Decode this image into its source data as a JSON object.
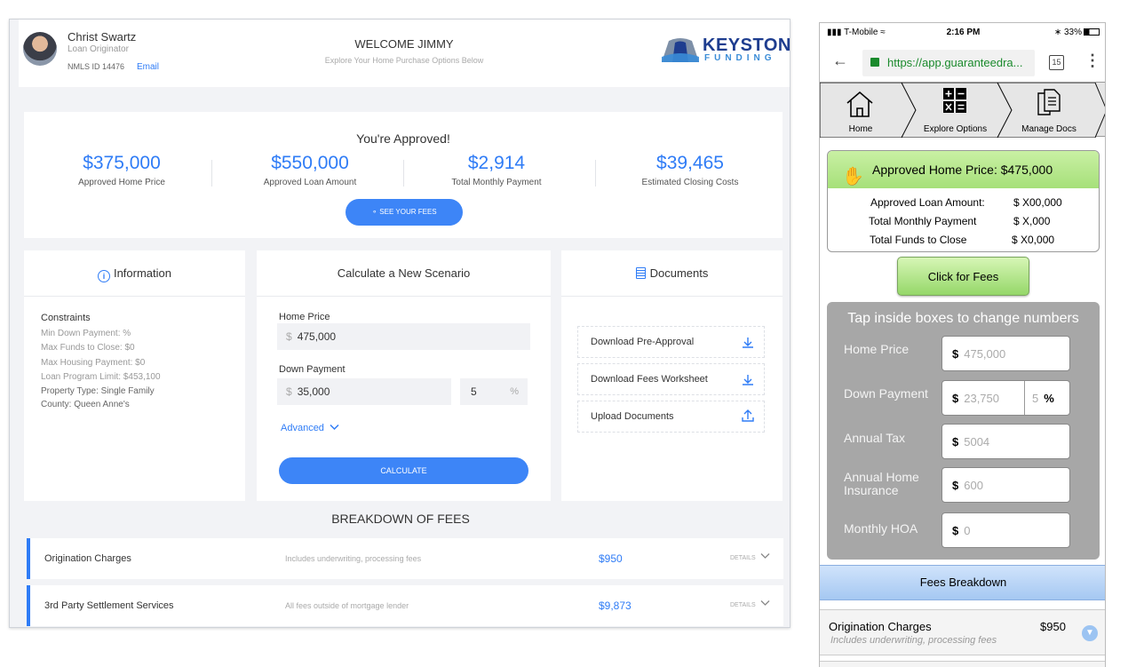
{
  "desktop": {
    "header": {
      "lo_name": "Christ Swartz",
      "lo_title": "Loan Originator",
      "nmls": "NMLS ID 14476",
      "email_label": "Email",
      "welcome": "WELCOME JIMMY",
      "welcome_sub": "Explore Your Home Purchase Options Below",
      "logo_main": "KEYSTONE",
      "logo_sub": "FUNDING"
    },
    "approved": {
      "title": "You're Approved!",
      "stats": [
        {
          "value": "$375,000",
          "label": "Approved Home Price"
        },
        {
          "value": "$550,000",
          "label": "Approved Loan Amount"
        },
        {
          "value": "$2,914",
          "label": "Total Monthly Payment"
        },
        {
          "value": "$39,465",
          "label": "Estimated Closing Costs"
        }
      ],
      "fees_button": "SEE YOUR FEES"
    },
    "information": {
      "title": "Information",
      "constraints_title": "Constraints",
      "lines": [
        "Min Down Payment: %",
        "Max Funds to Close: $0",
        "Max Housing Payment: $0",
        "Loan Program Limit: $453,100",
        "Property Type: Single Family",
        "County: Queen Anne's"
      ]
    },
    "calculator": {
      "title": "Calculate a New Scenario",
      "home_price_label": "Home Price",
      "currency": "$",
      "home_price_value": "475,000",
      "down_payment_label": "Down Payment",
      "down_payment_value": "35,000",
      "down_payment_pct": "5",
      "pct_symbol": "%",
      "advanced_label": "Advanced",
      "calculate_button": "CALCULATE"
    },
    "documents": {
      "title": "Documents",
      "items": [
        "Download Pre-Approval",
        "Download Fees Worksheet",
        "Upload Documents"
      ]
    },
    "breakdown": {
      "title": "BREAKDOWN OF FEES",
      "details_label": "DETAILS",
      "rows": [
        {
          "name": "Origination Charges",
          "desc": "Includes underwriting, processing fees",
          "amount": "$950"
        },
        {
          "name": "3rd Party Settlement Services",
          "desc": "All fees outside of mortgage lender",
          "amount": "$9,873"
        }
      ]
    }
  },
  "mobile": {
    "status": {
      "carrier": "T-Mobile",
      "time": "2:16 PM",
      "battery": "33%"
    },
    "url": "https://app.guaranteedra...",
    "tab_count": "15",
    "nav": [
      "Home",
      "Explore Options",
      "Manage Docs"
    ],
    "approved": {
      "head": "Approved Home Price: $475,000",
      "rows": [
        {
          "label": "Approved Loan Amount:",
          "value": "$ X00,000"
        },
        {
          "label": "Total Monthly Payment",
          "value": "$ X,000"
        },
        {
          "label": "Total Funds to Close",
          "value": "$ X0,000"
        }
      ]
    },
    "click_fees": "Click for Fees",
    "calc": {
      "title": "Tap inside boxes to change numbers",
      "currency": "$",
      "pct_symbol": "%",
      "fields": [
        {
          "label": "Home Price",
          "value": "475,000"
        },
        {
          "label": "Down Payment",
          "value": "23,750",
          "pct": "5"
        },
        {
          "label": "Annual Tax",
          "value": "5004"
        },
        {
          "label": "Annual Home Insurance",
          "value": "600"
        },
        {
          "label": "Monthly HOA",
          "value": "0"
        }
      ]
    },
    "fees_breakdown": "Fees Breakdown",
    "fee_row": {
      "name": "Origination Charges",
      "desc": "Includes underwriting, processing fees",
      "amount": "$950"
    }
  }
}
